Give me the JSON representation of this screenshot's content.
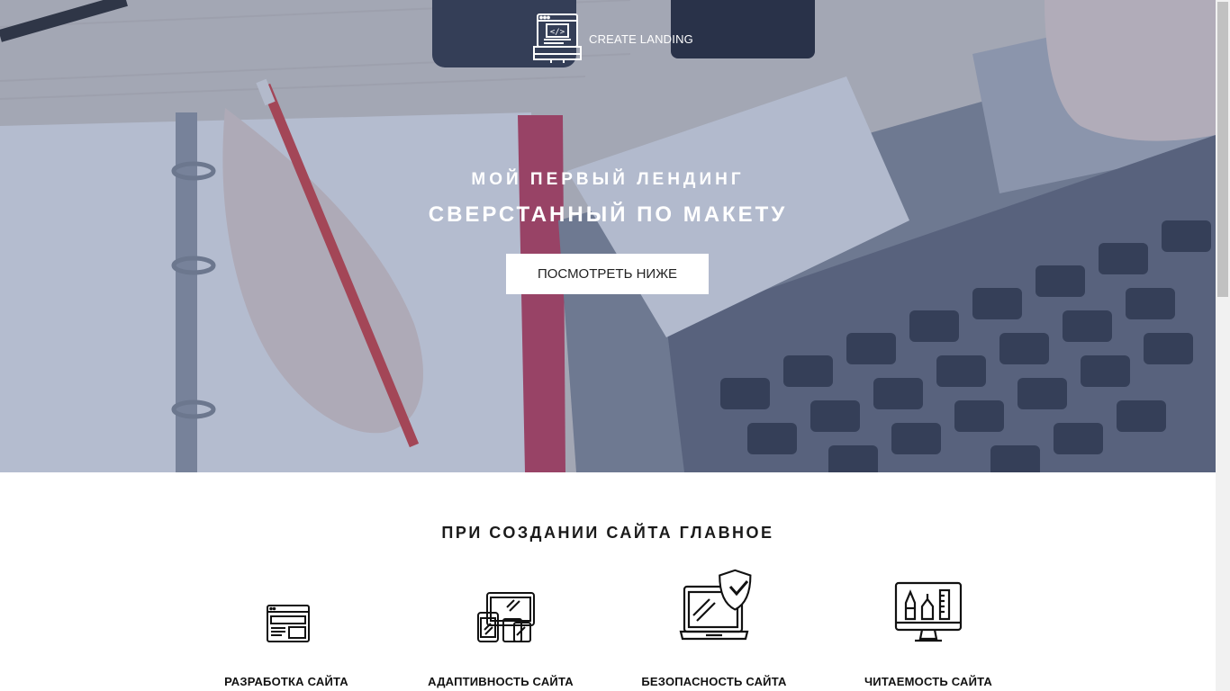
{
  "logo": {
    "text": "CREATE LANDING",
    "icon": "code-window-icon"
  },
  "hero": {
    "title_line1": "МОЙ ПЕРВЫЙ ЛЕНДИНГ",
    "title_line2": "СВЕРСТАННЫЙ ПО МАКЕТУ",
    "cta_label": "ПОСМОТРЕТЬ НИЖЕ"
  },
  "features": {
    "title": "ПРИ СОЗДАНИИ САЙТА ГЛАВНОЕ",
    "items": [
      {
        "label": "РАЗРАБОТКА САЙТА",
        "icon": "browser-window-icon"
      },
      {
        "label": "АДАПТИВНОСТЬ САЙТА",
        "icon": "responsive-devices-icon"
      },
      {
        "label": "БЕЗОПАСНОСТЬ САЙТА",
        "icon": "laptop-shield-icon"
      },
      {
        "label": "ЧИТАЕМОСТЬ САЙТА",
        "icon": "monitor-design-tools-icon"
      }
    ]
  },
  "colors": {
    "hero_overlay": "#283e78",
    "pencil": "#d94a4a",
    "notebook_spine": "#c9465f",
    "text_dark": "#111111"
  }
}
